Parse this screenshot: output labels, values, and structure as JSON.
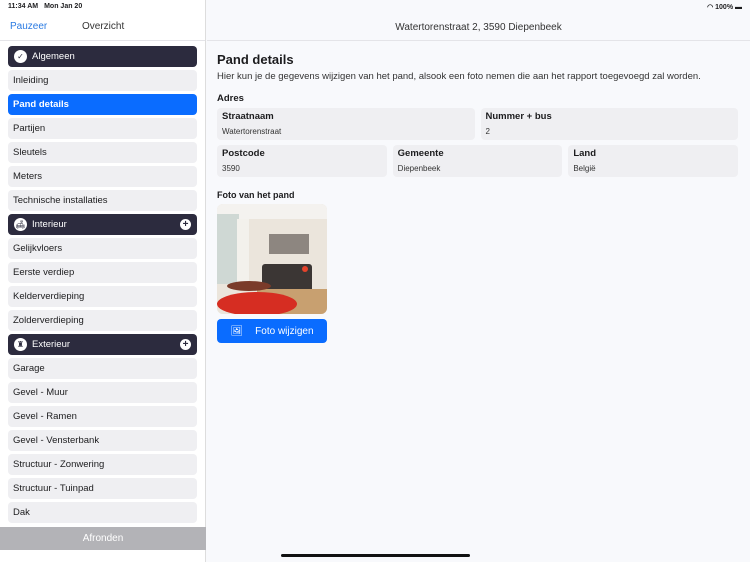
{
  "status": {
    "time": "11:34 AM",
    "date": "Mon Jan 20",
    "battery": "100%"
  },
  "sidebar": {
    "pause": "Pauzeer",
    "title": "Overzicht",
    "footer": "Afronden",
    "groups": [
      {
        "label": "Algemeen",
        "items": [
          "Inleiding",
          "Pand details",
          "Partijen",
          "Sleutels",
          "Meters",
          "Technische installaties"
        ]
      },
      {
        "label": "Interieur",
        "items": [
          "Gelijkvloers",
          "Eerste verdiep",
          "Kelderverdieping",
          "Zolderverdieping"
        ]
      },
      {
        "label": "Exterieur",
        "items": [
          "Garage",
          "Gevel - Muur",
          "Gevel - Ramen",
          "Gevel - Vensterbank",
          "Structuur - Zonwering",
          "Structuur - Tuinpad",
          "Dak"
        ]
      }
    ]
  },
  "header": {
    "title": "Watertorenstraat 2, 3590 Diepenbeek"
  },
  "main": {
    "title": "Pand details",
    "description": "Hier kun je de gegevens wijzigen van het pand, alsook een foto nemen die aan het rapport toegevoegd zal worden.",
    "address_label": "Adres",
    "fields": {
      "street": {
        "label": "Straatnaam",
        "value": "Watertorenstraat"
      },
      "number": {
        "label": "Nummer + bus",
        "value": "2"
      },
      "postcode": {
        "label": "Postcode",
        "value": "3590"
      },
      "city": {
        "label": "Gemeente",
        "value": "Diepenbeek"
      },
      "country": {
        "label": "Land",
        "value": "België"
      }
    },
    "photo_label": "Foto van het pand",
    "photo_button": "Foto wijzigen"
  },
  "colors": {
    "accent": "#0a6cff",
    "group": "#2c2b3e"
  }
}
